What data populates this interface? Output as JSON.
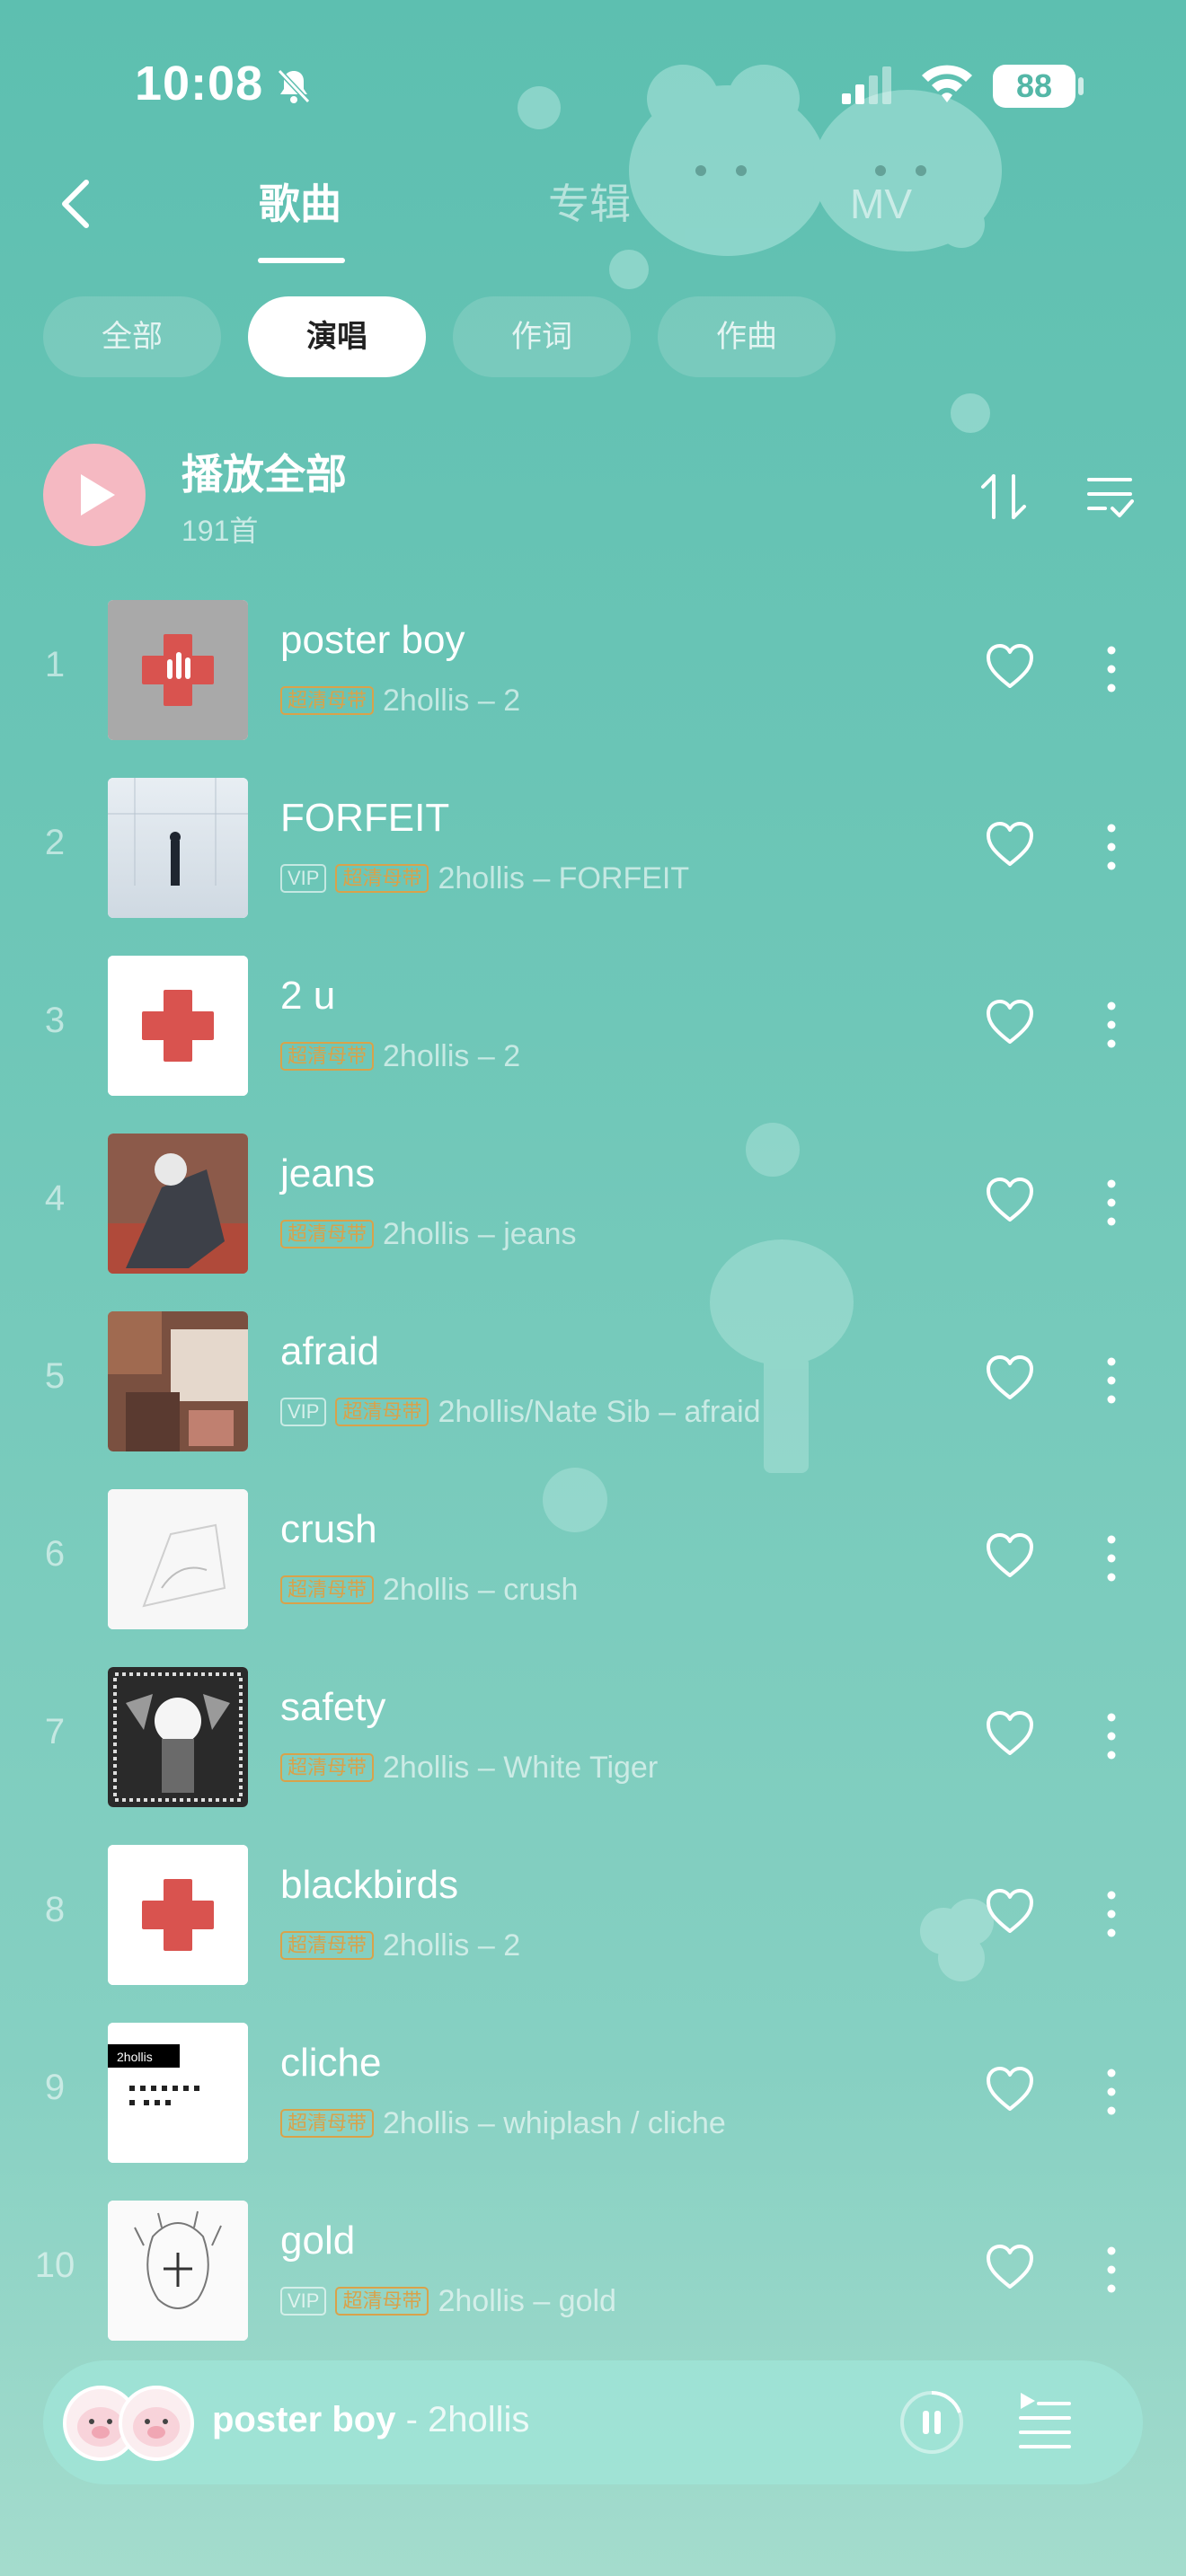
{
  "status": {
    "time": "10:08",
    "battery": "88"
  },
  "nav": {
    "tabs": [
      {
        "label": "歌曲",
        "active": true
      },
      {
        "label": "专辑",
        "active": false
      },
      {
        "label": "MV",
        "active": false
      }
    ]
  },
  "filters": [
    {
      "label": "全部",
      "active": false
    },
    {
      "label": "演唱",
      "active": true
    },
    {
      "label": "作词",
      "active": false
    },
    {
      "label": "作曲",
      "active": false
    }
  ],
  "play_all": {
    "label": "播放全部",
    "count": "191首"
  },
  "songs": [
    {
      "index": "1",
      "title": "poster boy",
      "vip": false,
      "hq": "超清母带",
      "subtitle": "2hollis – 2",
      "cover": "red-cross-gray"
    },
    {
      "index": "2",
      "title": "FORFEIT",
      "vip": true,
      "hq": "超清母带",
      "subtitle": "2hollis – FORFEIT",
      "cover": "white-room"
    },
    {
      "index": "3",
      "title": "2 u",
      "vip": false,
      "hq": "超清母带",
      "subtitle": "2hollis – 2",
      "cover": "red-cross"
    },
    {
      "index": "4",
      "title": "jeans",
      "vip": false,
      "hq": "超清母带",
      "subtitle": "2hollis – jeans",
      "cover": "photo-dark"
    },
    {
      "index": "5",
      "title": "afraid",
      "vip": true,
      "hq": "超清母带",
      "subtitle": "2hollis/Nate Sib – afraid",
      "cover": "photo-collage"
    },
    {
      "index": "6",
      "title": "crush",
      "vip": false,
      "hq": "超清母带",
      "subtitle": "2hollis – crush",
      "cover": "white-sketch"
    },
    {
      "index": "7",
      "title": "safety",
      "vip": false,
      "hq": "超清母带",
      "subtitle": "2hollis – White Tiger",
      "cover": "tiger-bw"
    },
    {
      "index": "8",
      "title": "blackbirds",
      "vip": false,
      "hq": "超清母带",
      "subtitle": "2hollis – 2",
      "cover": "red-cross"
    },
    {
      "index": "9",
      "title": "cliche",
      "vip": false,
      "hq": "超清母带",
      "subtitle": "2hollis – whiplash / cliche",
      "cover": "text-cover"
    },
    {
      "index": "10",
      "title": "gold",
      "vip": true,
      "hq": "超清母带",
      "subtitle": "2hollis – gold",
      "cover": "sketch-face"
    }
  ],
  "vip_label": "VIP",
  "cover_text": {
    "cliche": "2hollis"
  },
  "mini_player": {
    "title": "poster boy",
    "separator": " - ",
    "artist": "2hollis"
  },
  "colors": {
    "background": "#5dbfb0",
    "hq_badge": "#d9a24a",
    "play_button": "#f5b9c2",
    "cross": "#d9534f"
  }
}
